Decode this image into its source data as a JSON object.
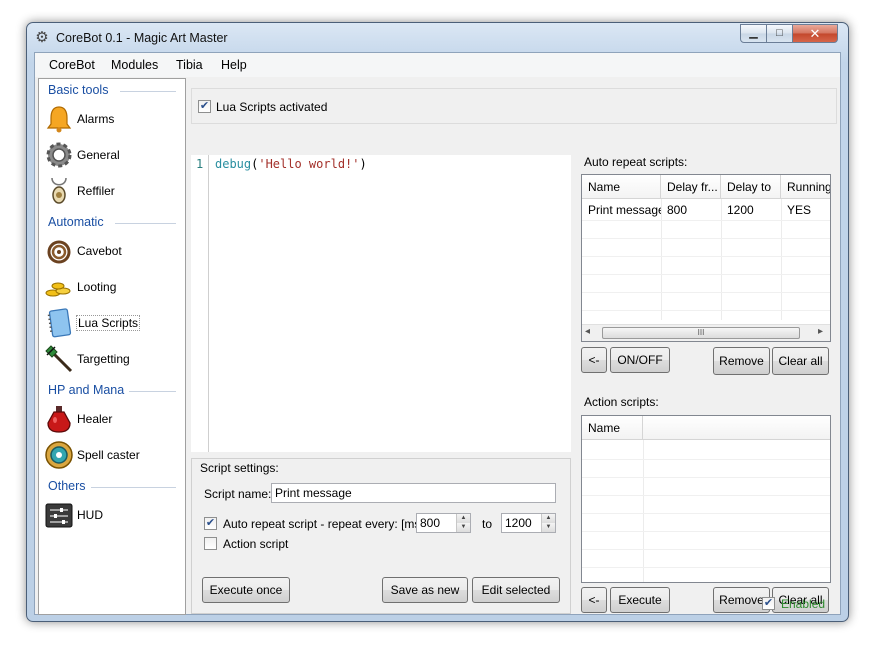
{
  "window": {
    "title": "CoreBot 0.1 - Magic Art Master",
    "min_glyph": "▁",
    "max_glyph": "□",
    "close_glyph": "✕"
  },
  "menu": [
    "CoreBot",
    "Modules",
    "Tibia",
    "Help"
  ],
  "sidebar": {
    "sections": [
      "Basic tools",
      "Automatic",
      "HP and Mana",
      "Others"
    ],
    "items": [
      "Alarms",
      "General",
      "Reffiler",
      "Cavebot",
      "Looting",
      "Lua Scripts",
      "Targetting",
      "Healer",
      "Spell caster",
      "HUD"
    ],
    "selected": "Lua Scripts"
  },
  "lua": {
    "activated_label": "Lua Scripts activated",
    "activated": true,
    "editor": {
      "line_number": "1",
      "code_fn": "debug",
      "code_open": "(",
      "code_str": "'Hello world!'",
      "code_close": ")"
    }
  },
  "settings": {
    "group_label": "Script settings:",
    "name_label": "Script name:",
    "name_value": "Print message",
    "auto_repeat_label": "Auto repeat script - repeat every: [ms]",
    "auto_repeat_checked": true,
    "delay_from": "800",
    "to_label": "to",
    "delay_to": "1200",
    "action_label": "Action script",
    "action_checked": false,
    "execute_once": "Execute once",
    "save_as_new": "Save as new",
    "edit_selected": "Edit selected"
  },
  "auto_repeat": {
    "label": "Auto repeat scripts:",
    "columns": [
      "Name",
      "Delay fr...",
      "Delay to",
      "Running"
    ],
    "rows": [
      [
        "Print message",
        "800",
        "1200",
        "YES"
      ]
    ],
    "btn_back": "<-",
    "btn_toggle": "ON/OFF",
    "btn_remove": "Remove",
    "btn_clear": "Clear all",
    "scroll_left": "◂",
    "scroll_right": "▸",
    "scroll_grip": "III"
  },
  "action_scripts": {
    "label": "Action scripts:",
    "columns": [
      "Name"
    ],
    "btn_back": "<-",
    "btn_execute": "Execute",
    "btn_remove": "Remove",
    "btn_clear": "Clear all"
  },
  "enabled": {
    "label": "Enabled",
    "checked": true,
    "color": "#2e8b2e"
  },
  "colors": {
    "section_title": "#1a4fa3",
    "code_fn": "#2a8fa0",
    "code_str": "#a3302a",
    "line_no": "#2a7f7f"
  }
}
